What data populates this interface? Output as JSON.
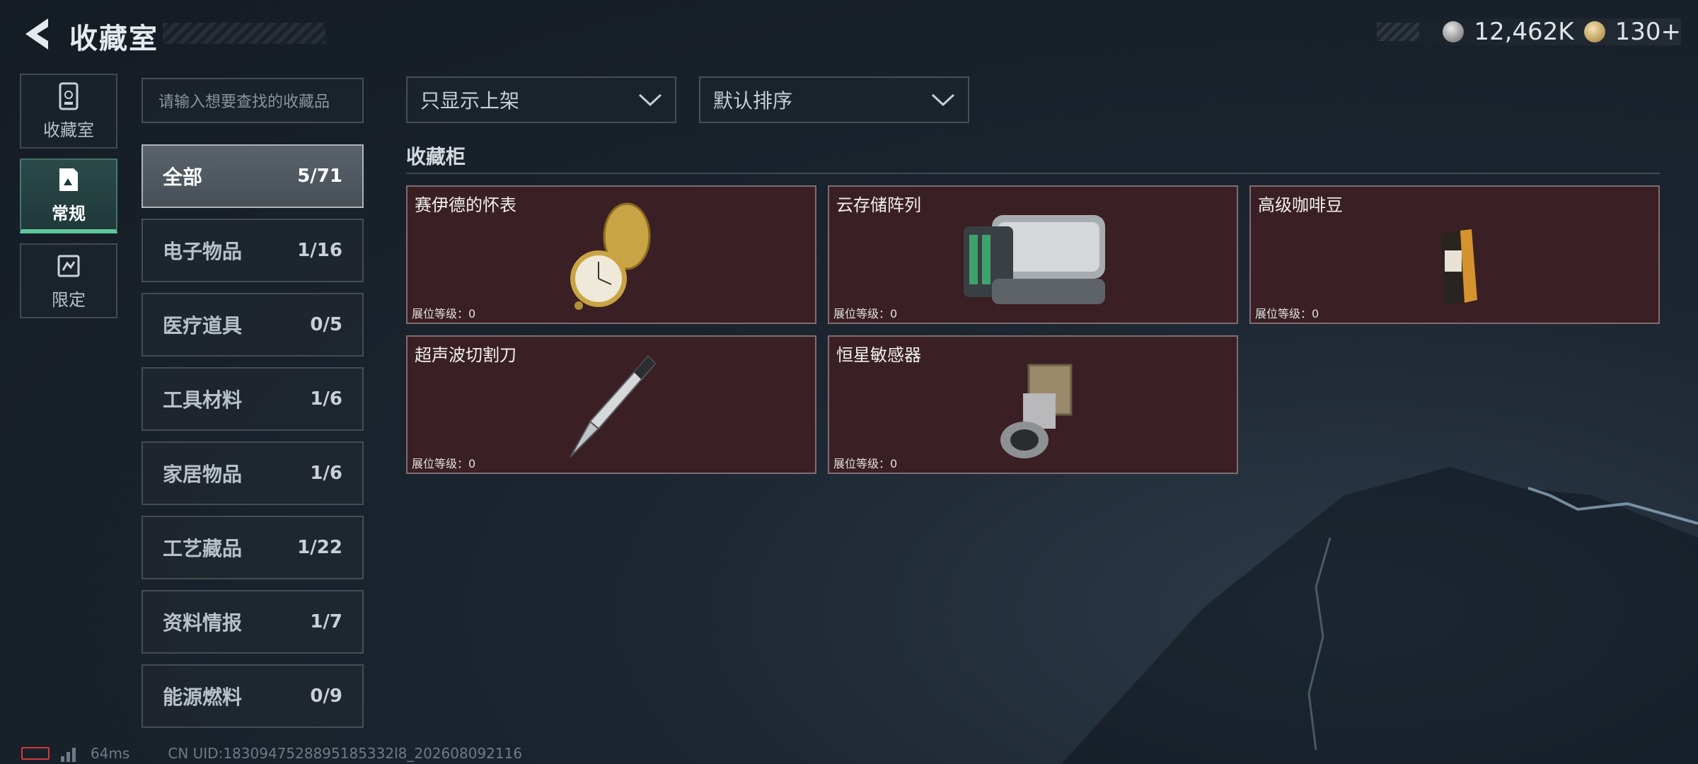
{
  "header": {
    "title": "收藏室",
    "currency_primary": "12,462K",
    "currency_secondary": "130+"
  },
  "modes": [
    {
      "label": "收藏室",
      "icon": "collection-room-icon",
      "active": false
    },
    {
      "label": "常规",
      "icon": "regular-icon",
      "active": true
    },
    {
      "label": "限定",
      "icon": "limited-icon",
      "active": false
    }
  ],
  "search": {
    "placeholder": "请输入想要查找的收藏品"
  },
  "categories": [
    {
      "name": "全部",
      "count": "5/71"
    },
    {
      "name": "电子物品",
      "count": "1/16"
    },
    {
      "name": "医疗道具",
      "count": "0/5"
    },
    {
      "name": "工具材料",
      "count": "1/6"
    },
    {
      "name": "家居物品",
      "count": "1/6"
    },
    {
      "name": "工艺藏品",
      "count": "1/22"
    },
    {
      "name": "资料情报",
      "count": "1/7"
    },
    {
      "name": "能源燃料",
      "count": "0/9"
    }
  ],
  "filters": {
    "display": "只显示上架",
    "sort": "默认排序"
  },
  "section": {
    "title": "收藏柜"
  },
  "items": [
    {
      "name": "赛伊德的怀表",
      "level": "展位等级：0",
      "icon": "pocket-watch-icon"
    },
    {
      "name": "云存储阵列",
      "level": "展位等级：0",
      "icon": "storage-array-icon"
    },
    {
      "name": "高级咖啡豆",
      "level": "展位等级：0",
      "icon": "coffee-bag-icon"
    },
    {
      "name": "超声波切割刀",
      "level": "展位等级：0",
      "icon": "ultrasonic-knife-icon"
    },
    {
      "name": "恒星敏感器",
      "level": "展位等级：0",
      "icon": "star-sensor-icon"
    }
  ],
  "footer": {
    "ping": "64ms",
    "uid": "CN UID:1830947528895185332l8_202608092116"
  },
  "colors": {
    "card_bg": "#3a1f24",
    "active_tab_accent": "#5fc79c",
    "battery_low": "#d03a3a"
  }
}
